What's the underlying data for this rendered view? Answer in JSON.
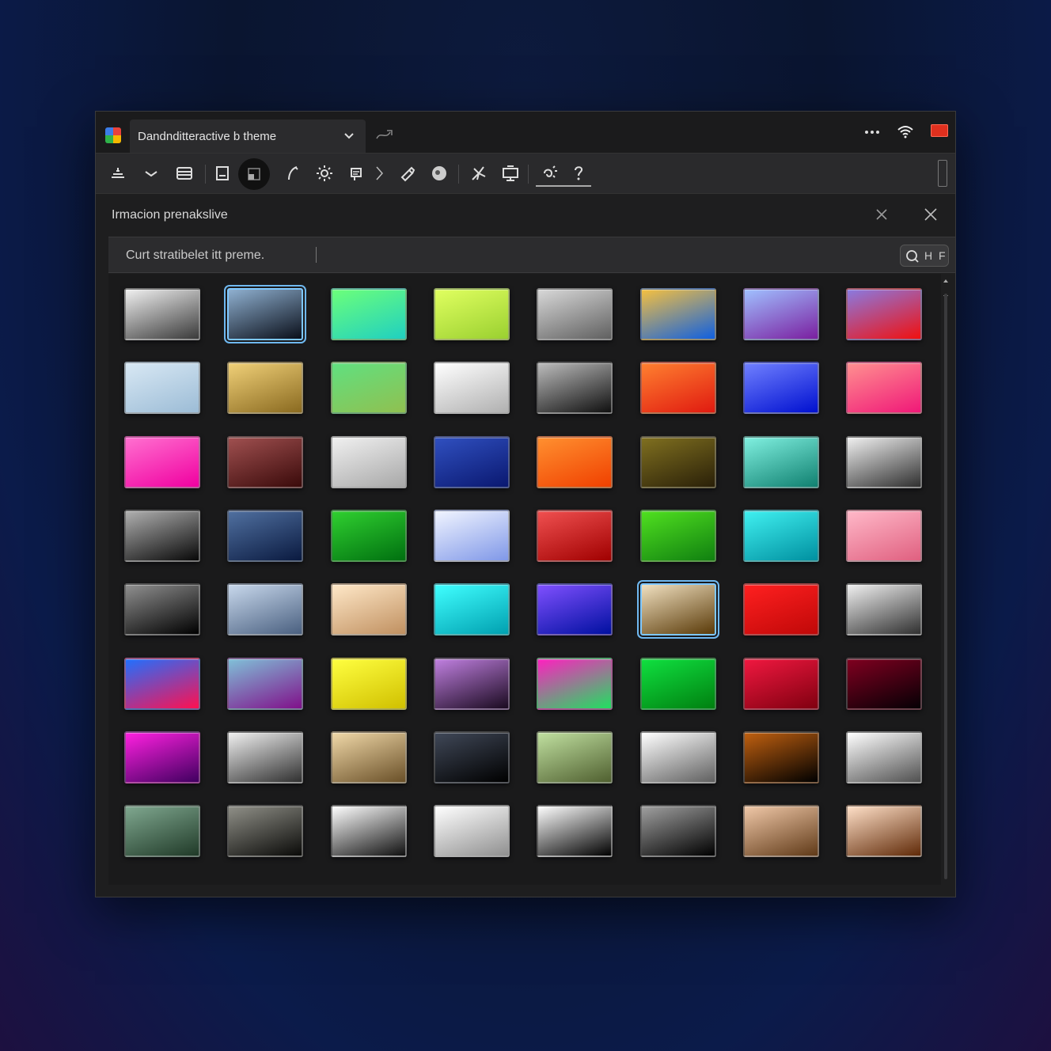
{
  "window": {
    "tab_title": "Dandnditteractive b theme"
  },
  "panel": {
    "title": "Irmacion prenakslive"
  },
  "search": {
    "text": "Curt stratibelet itt preme.",
    "button_label": "H",
    "button_label2": "F"
  },
  "icons": {
    "toolbar": [
      "align-icon",
      "chevron-down-icon",
      "list-icon",
      "image-icon",
      "layer-icon",
      "brush-icon",
      "sun-icon",
      "paint-bucket-icon",
      "chevron-right-icon",
      "pen-icon",
      "blob-icon",
      "magic-wand-icon",
      "monitor-icon",
      "wand-spark-icon",
      "help-icon"
    ]
  },
  "swatches": [
    [
      [
        "#f0f0f0",
        "#3a3a3a"
      ],
      [
        "#8fb0d0",
        "#0a0f1a"
      ],
      [
        "#6cff7a",
        "#20d0c0"
      ],
      [
        "#e0ff60",
        "#9ad030"
      ],
      [
        "#d8d8d8",
        "#606060"
      ],
      [
        "#f5c040",
        "#1060e0"
      ],
      [
        "#a0c0ff",
        "#7a1fa0"
      ],
      [
        "#8a7ae0",
        "#f01010"
      ]
    ],
    [
      [
        "#d8e8f4",
        "#9cbcd6"
      ],
      [
        "#f0d078",
        "#8a6a20"
      ],
      [
        "#60e080",
        "#90c050"
      ],
      [
        "#ffffff",
        "#b0b0b0"
      ],
      [
        "#bcbcbc",
        "#101010"
      ],
      [
        "#ff8030",
        "#e01a10"
      ],
      [
        "#7080ff",
        "#0010d0"
      ],
      [
        "#ff9090",
        "#f01878"
      ]
    ],
    [
      [
        "#ff70d0",
        "#f000a0"
      ],
      [
        "#a05050",
        "#3a0a0a"
      ],
      [
        "#f0f0f0",
        "#a8a8a8"
      ],
      [
        "#3050c0",
        "#0a1870"
      ],
      [
        "#ff9030",
        "#f04000"
      ],
      [
        "#807020",
        "#2a2008"
      ],
      [
        "#80f0e0",
        "#108070"
      ],
      [
        "#f0f0f0",
        "#303030"
      ]
    ],
    [
      [
        "#b0b0b0",
        "#080808"
      ],
      [
        "#5070a0",
        "#0a1a40"
      ],
      [
        "#30d030",
        "#007010"
      ],
      [
        "#f0f4ff",
        "#8098e8"
      ],
      [
        "#f05050",
        "#a00000"
      ],
      [
        "#50e020",
        "#108010"
      ],
      [
        "#40f0f0",
        "#0090a0"
      ],
      [
        "#ffb8c8",
        "#e06080"
      ]
    ],
    [
      [
        "#909090",
        "#000000"
      ],
      [
        "#c8d8ec",
        "#4a6080"
      ],
      [
        "#ffe8c8",
        "#c09060"
      ],
      [
        "#40ffff",
        "#00a0b0"
      ],
      [
        "#8050ff",
        "#0010a0"
      ],
      [
        "#f0e0c0",
        "#5a3a08"
      ],
      [
        "#ff2020",
        "#c00808"
      ],
      [
        "#f0f0f0",
        "#303030"
      ]
    ],
    [
      [
        "#2070ff",
        "#ff1050"
      ],
      [
        "#80c0d8",
        "#80108a"
      ],
      [
        "#ffff40",
        "#d0c000"
      ],
      [
        "#c080e0",
        "#1a0a20"
      ],
      [
        "#ff20c0",
        "#20e060"
      ],
      [
        "#10e040",
        "#008010"
      ],
      [
        "#f01840",
        "#800010"
      ],
      [
        "#800020",
        "#050005"
      ]
    ],
    [
      [
        "#ff20e0",
        "#400060"
      ],
      [
        "#f0f0f0",
        "#303030"
      ],
      [
        "#f0d8a8",
        "#6a5028"
      ],
      [
        "#404858",
        "#000000"
      ],
      [
        "#c0e0a0",
        "#506030"
      ],
      [
        "#ffffff",
        "#606060"
      ],
      [
        "#c06010",
        "#000000"
      ],
      [
        "#ffffff",
        "#505050"
      ]
    ],
    [
      [
        "#80a890",
        "#203a28"
      ],
      [
        "#909088",
        "#0a0a08"
      ],
      [
        "#ffffff",
        "#101010"
      ],
      [
        "#ffffff",
        "#909090"
      ],
      [
        "#ffffff",
        "#000000"
      ],
      [
        "#a0a0a0",
        "#000000"
      ],
      [
        "#f0c8a8",
        "#603a18"
      ],
      [
        "#ffe0c8",
        "#602a08"
      ]
    ]
  ],
  "selected": [
    [
      0,
      1
    ],
    [
      4,
      5
    ]
  ]
}
